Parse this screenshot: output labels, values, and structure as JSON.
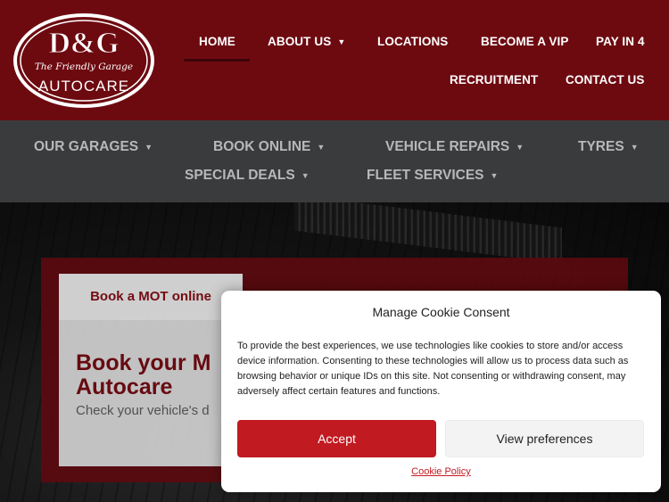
{
  "brand": {
    "logo_main": "D&G",
    "logo_tagline": "The Friendly Garage",
    "logo_sub": "AUTOCARE",
    "colors": {
      "header_bg": "#6d0a10",
      "subnav_bg": "#3a3b3d",
      "accent_red": "#c21a21"
    }
  },
  "top_nav": {
    "items": [
      {
        "label": "HOME",
        "active": true
      },
      {
        "label": "ABOUT US",
        "has_dropdown": true
      },
      {
        "label": "LOCATIONS"
      },
      {
        "label": "BECOME A VIP"
      },
      {
        "label": "PAY IN 4"
      },
      {
        "label": "RECRUITMENT"
      },
      {
        "label": "CONTACT US"
      }
    ],
    "caret_icon": "chevron-down-icon"
  },
  "sub_nav": {
    "items": [
      {
        "label": "OUR GARAGES"
      },
      {
        "label": "BOOK ONLINE"
      },
      {
        "label": "VEHICLE REPAIRS"
      },
      {
        "label": "TYRES"
      },
      {
        "label": "SPECIAL DEALS"
      },
      {
        "label": "FLEET SERVICES"
      }
    ]
  },
  "hero": {
    "button_label": "Book a MOT online",
    "title": "Book your M Autocare",
    "subtitle": "Check your vehicle's d"
  },
  "cookie_consent": {
    "title": "Manage Cookie Consent",
    "body": "To provide the best experiences, we use technologies like cookies to store and/or access device information. Consenting to these technologies will allow us to process data such as browsing behavior or unique IDs on this site. Not consenting or withdrawing consent, may adversely affect certain features and functions.",
    "accept_label": "Accept",
    "preferences_label": "View preferences",
    "policy_link": "Cookie Policy"
  }
}
